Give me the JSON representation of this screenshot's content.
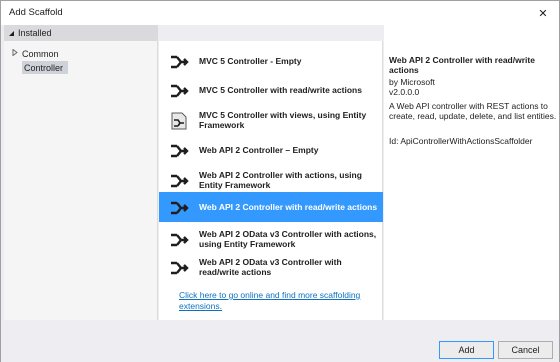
{
  "window": {
    "title": "Add Scaffold",
    "close_glyph": "✕"
  },
  "left": {
    "installed_label": "Installed",
    "tree": [
      {
        "label": "Common",
        "collapsed": true
      },
      {
        "label": "Controller",
        "selected": true
      }
    ]
  },
  "items": [
    {
      "label": "MVC 5 Controller - Empty",
      "icon": "controller-icon"
    },
    {
      "label": "MVC 5 Controller with read/write actions",
      "icon": "controller-icon"
    },
    {
      "label": "MVC 5 Controller with views, using Entity Framework",
      "icon": "controller-views-icon"
    },
    {
      "label": "Web API 2 Controller – Empty",
      "icon": "controller-icon"
    },
    {
      "label": "Web API 2 Controller with actions, using Entity Framework",
      "icon": "controller-icon"
    },
    {
      "label": "Web API 2 Controller with read/write actions",
      "icon": "controller-icon",
      "selected": true
    },
    {
      "label": "Web API 2 OData v3 Controller with actions, using Entity Framework",
      "icon": "controller-icon"
    },
    {
      "label": "Web API 2 OData v3 Controller with read/write actions",
      "icon": "controller-icon"
    }
  ],
  "online_link": "Click here to go online and find more scaffolding extensions.",
  "details": {
    "title": "Web API 2 Controller with read/write actions",
    "author": "by Microsoft",
    "version": "v2.0.0.0",
    "description": "A Web API controller with REST actions to create, read, update, delete, and list entities.",
    "id": "Id: ApiControllerWithActionsScaffolder"
  },
  "buttons": {
    "add": "Add",
    "cancel": "Cancel"
  },
  "colors": {
    "selection": "#3399ff",
    "link": "#0e70c0",
    "panel_bg": "#eeeef2"
  }
}
